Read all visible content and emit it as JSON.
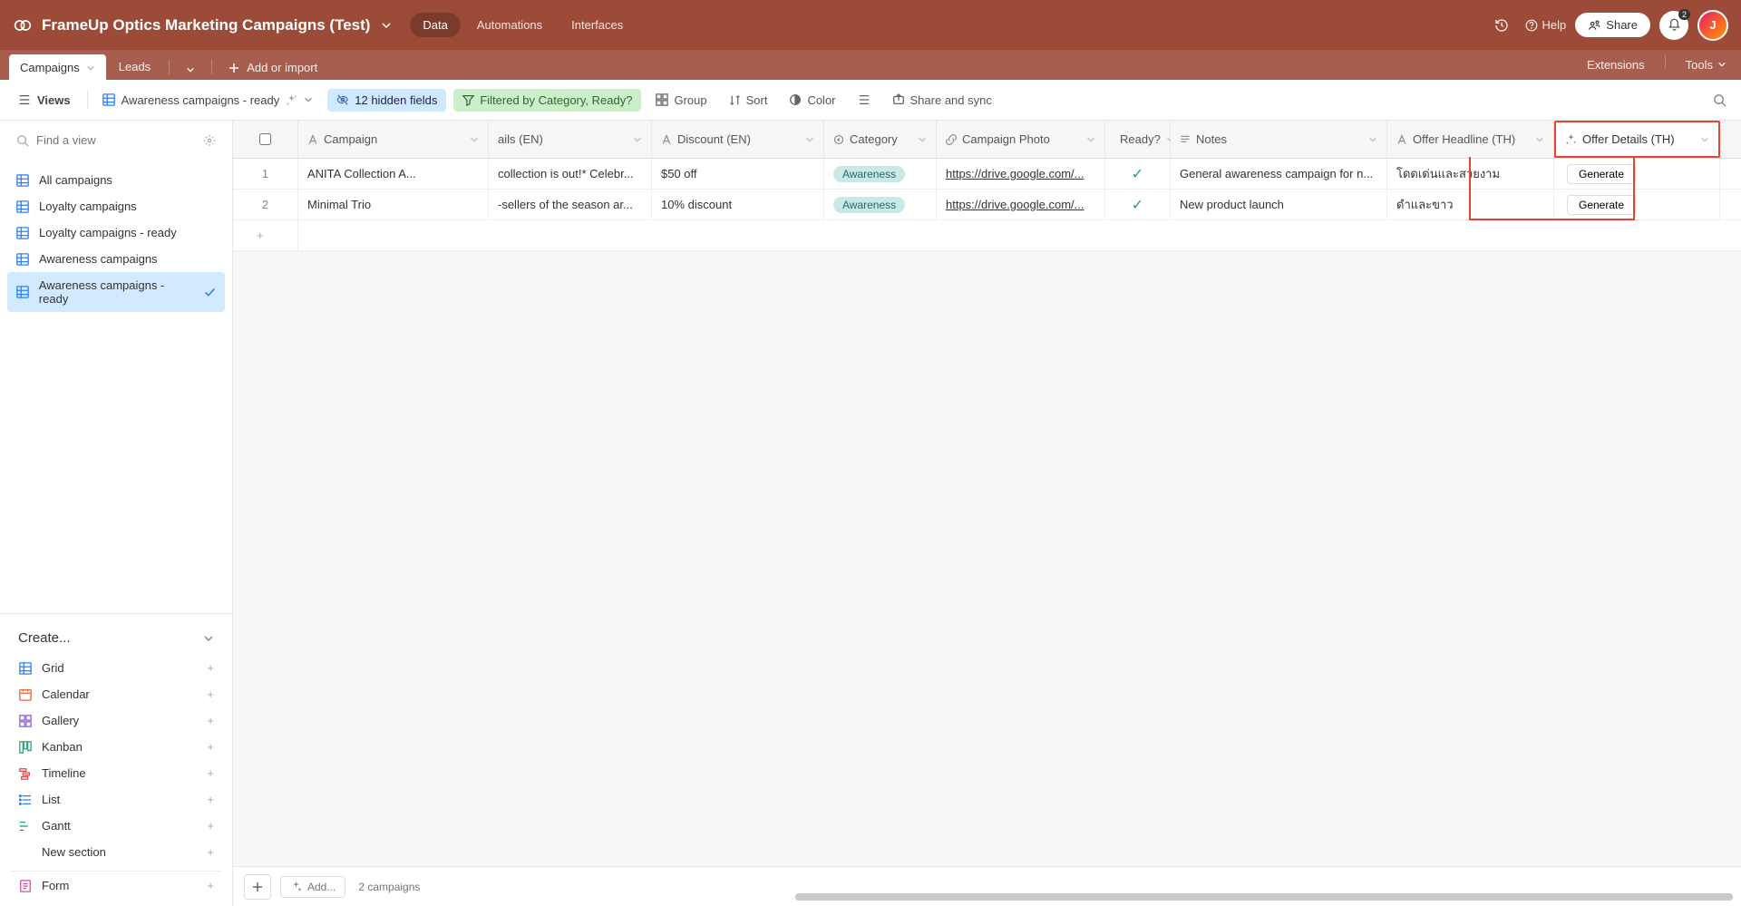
{
  "header": {
    "baseName": "FrameUp Optics Marketing Campaigns (Test)",
    "tabs": {
      "data": "Data",
      "automations": "Automations",
      "interfaces": "Interfaces"
    },
    "help": "Help",
    "share": "Share",
    "notifCount": "2",
    "avatar": "J"
  },
  "tablesBar": {
    "tables": [
      "Campaigns",
      "Leads"
    ],
    "addOrImport": "Add or import",
    "extensions": "Extensions",
    "tools": "Tools"
  },
  "viewBar": {
    "viewsLabel": "Views",
    "currentView": "Awareness campaigns - ready",
    "hiddenFields": "12 hidden fields",
    "filteredBy": "Filtered by Category, Ready?",
    "group": "Group",
    "sort": "Sort",
    "color": "Color",
    "shareSync": "Share and sync"
  },
  "sidebar": {
    "findPlaceholder": "Find a view",
    "views": [
      "All campaigns",
      "Loyalty campaigns",
      "Loyalty campaigns - ready",
      "Awareness campaigns",
      "Awareness campaigns - ready"
    ],
    "createHeader": "Create...",
    "createItems": {
      "grid": "Grid",
      "calendar": "Calendar",
      "gallery": "Gallery",
      "kanban": "Kanban",
      "timeline": "Timeline",
      "list": "List",
      "gantt": "Gantt",
      "newSection": "New section",
      "form": "Form"
    }
  },
  "columns": {
    "campaign": "Campaign",
    "detailsEn": "ails (EN)",
    "discountEn": "Discount (EN)",
    "category": "Category",
    "campaignPhoto": "Campaign Photo",
    "ready": "Ready?",
    "notes": "Notes",
    "offerHeadlineTh": "Offer Headline (TH)",
    "offerDetailsTh": "Offer Details (TH)"
  },
  "rows": [
    {
      "num": "1",
      "campaign": "ANITA Collection A...",
      "detailsEn": "collection is out!* Celebr...",
      "discountEn": "$50 off",
      "category": "Awareness",
      "photo": "https://drive.google.com/...",
      "readyChecked": true,
      "notes": "General awareness campaign for n...",
      "headlineTh": "โดดเด่นและสวยงาม",
      "detailsThBtn": "Generate"
    },
    {
      "num": "2",
      "campaign": "Minimal Trio",
      "detailsEn": "-sellers of the season ar...",
      "discountEn": "10% discount",
      "category": "Awareness",
      "photo": "https://drive.google.com/...",
      "readyChecked": true,
      "notes": "New product launch",
      "headlineTh": "ดำและขาว",
      "detailsThBtn": "Generate"
    }
  ],
  "footer": {
    "addText": "Add...",
    "count": "2 campaigns"
  }
}
